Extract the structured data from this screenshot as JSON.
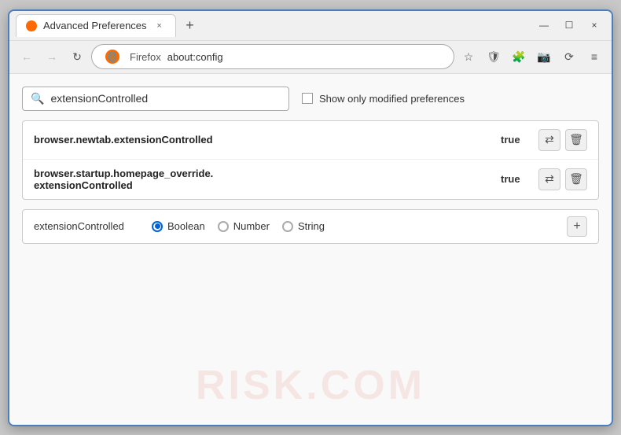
{
  "window": {
    "title": "Advanced Preferences",
    "tab_close": "×",
    "new_tab": "+",
    "win_minimize": "—",
    "win_maximize": "☐",
    "win_close": "×"
  },
  "navbar": {
    "back_label": "←",
    "forward_label": "→",
    "refresh_label": "↻",
    "brand": "Firefox",
    "url": "about:config",
    "star_icon": "☆",
    "menu_icon": "≡"
  },
  "search": {
    "placeholder": "extensionControlled",
    "value": "extensionControlled",
    "show_modified_label": "Show only modified preferences"
  },
  "results": [
    {
      "name": "browser.newtab.extensionControlled",
      "value": "true",
      "multiline": false
    },
    {
      "name1": "browser.startup.homepage_override.",
      "name2": "extensionControlled",
      "value": "true",
      "multiline": true
    }
  ],
  "add_pref": {
    "name": "extensionControlled",
    "type_options": [
      "Boolean",
      "Number",
      "String"
    ],
    "selected_type": "Boolean",
    "plus_label": "+"
  },
  "watermark": "RISK.COM",
  "icons": {
    "search": "🔍",
    "toggle": "⇄",
    "delete": "🗑",
    "shield": "🛡",
    "extension_icon": "🧩",
    "camera_icon": "📷"
  }
}
